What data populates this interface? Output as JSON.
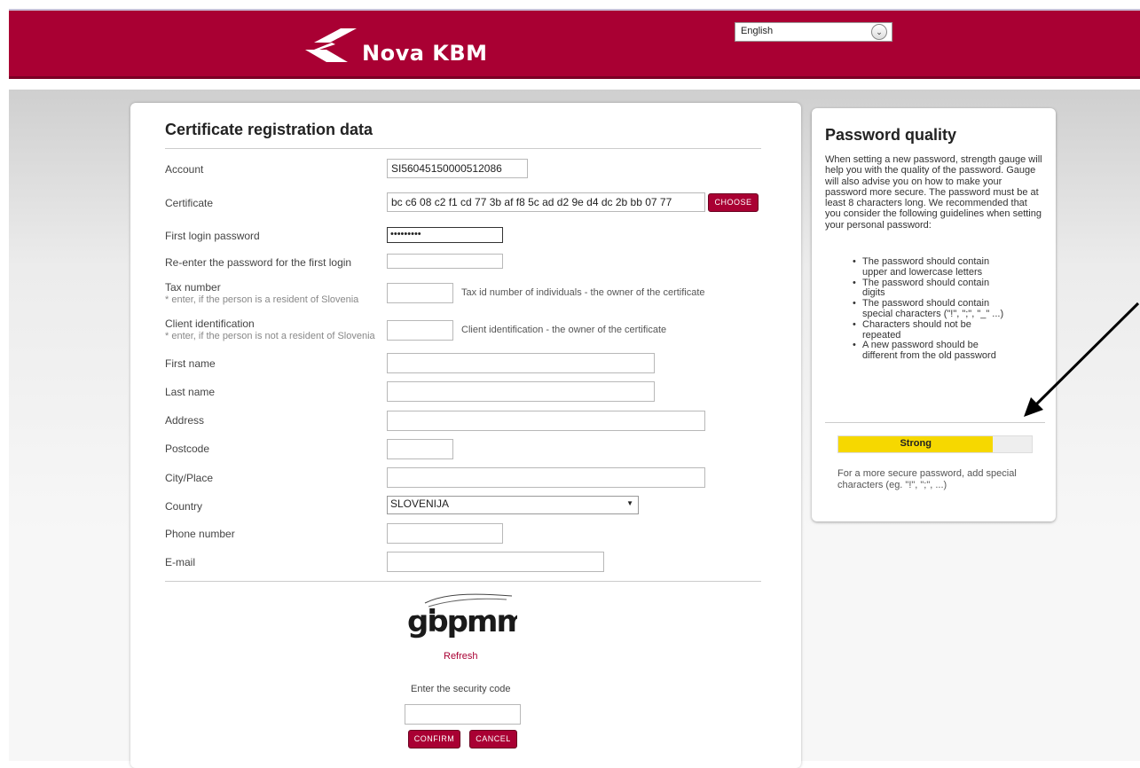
{
  "header": {
    "brand": "Nova KBM",
    "language": "English"
  },
  "form": {
    "title": "Certificate registration data",
    "account": {
      "label": "Account",
      "value": "SI56045150000512086"
    },
    "certificate": {
      "label": "Certificate",
      "value": "bc c6 08 c2 f1 cd 77 3b af f8 5c ad d2 9e d4 dc 2b bb 07 77",
      "button": "CHOOSE"
    },
    "first_login_password": {
      "label": "First login password",
      "value": "•••••••••"
    },
    "reenter_password": {
      "label": "Re-enter the password for the first login",
      "value": ""
    },
    "tax_number": {
      "label": "Tax number",
      "note": "* enter, if the person is a resident of Slovenia",
      "value": "",
      "hint": "Tax id number of individuals - the owner of the certificate"
    },
    "client_identification": {
      "label": "Client identification",
      "note": "* enter, if the person is not a resident of Slovenia",
      "value": "",
      "hint": "Client identification - the owner of the certificate"
    },
    "first_name": {
      "label": "First name",
      "value": ""
    },
    "last_name": {
      "label": "Last name",
      "value": ""
    },
    "address": {
      "label": "Address",
      "value": ""
    },
    "postcode": {
      "label": "Postcode",
      "value": ""
    },
    "city": {
      "label": "City/Place",
      "value": ""
    },
    "country": {
      "label": "Country",
      "value": "SLOVENIJA"
    },
    "phone": {
      "label": "Phone number",
      "value": ""
    },
    "email": {
      "label": "E-mail",
      "value": ""
    }
  },
  "captcha": {
    "code_image_text": "gbpmm",
    "refresh": "Refresh",
    "prompt": "Enter the security code",
    "value": "",
    "confirm": "CONFIRM",
    "cancel": "CANCEL"
  },
  "password_quality": {
    "title": "Password quality",
    "intro": "When setting a new password, strength gauge will help you with the quality of the password. Gauge will also advise you on how to make your password more secure. The password must be at least 8 characters long. We recommended that you consider the following guidelines when setting your personal password:",
    "guidelines": [
      "The password should contain upper and lowercase letters",
      "The password should contain digits",
      "The password should contain special characters (\"!\", \";\", \"_\" ...)",
      "Characters should not be repeated",
      "A new password should be different from the old password"
    ],
    "strength_label": "Strong",
    "strength_level": 0.8,
    "advice": "For a more secure password, add special characters (eg. \"!\", \";\", ...)"
  },
  "colors": {
    "brand": "#a90033",
    "gauge": "#f6d800"
  }
}
